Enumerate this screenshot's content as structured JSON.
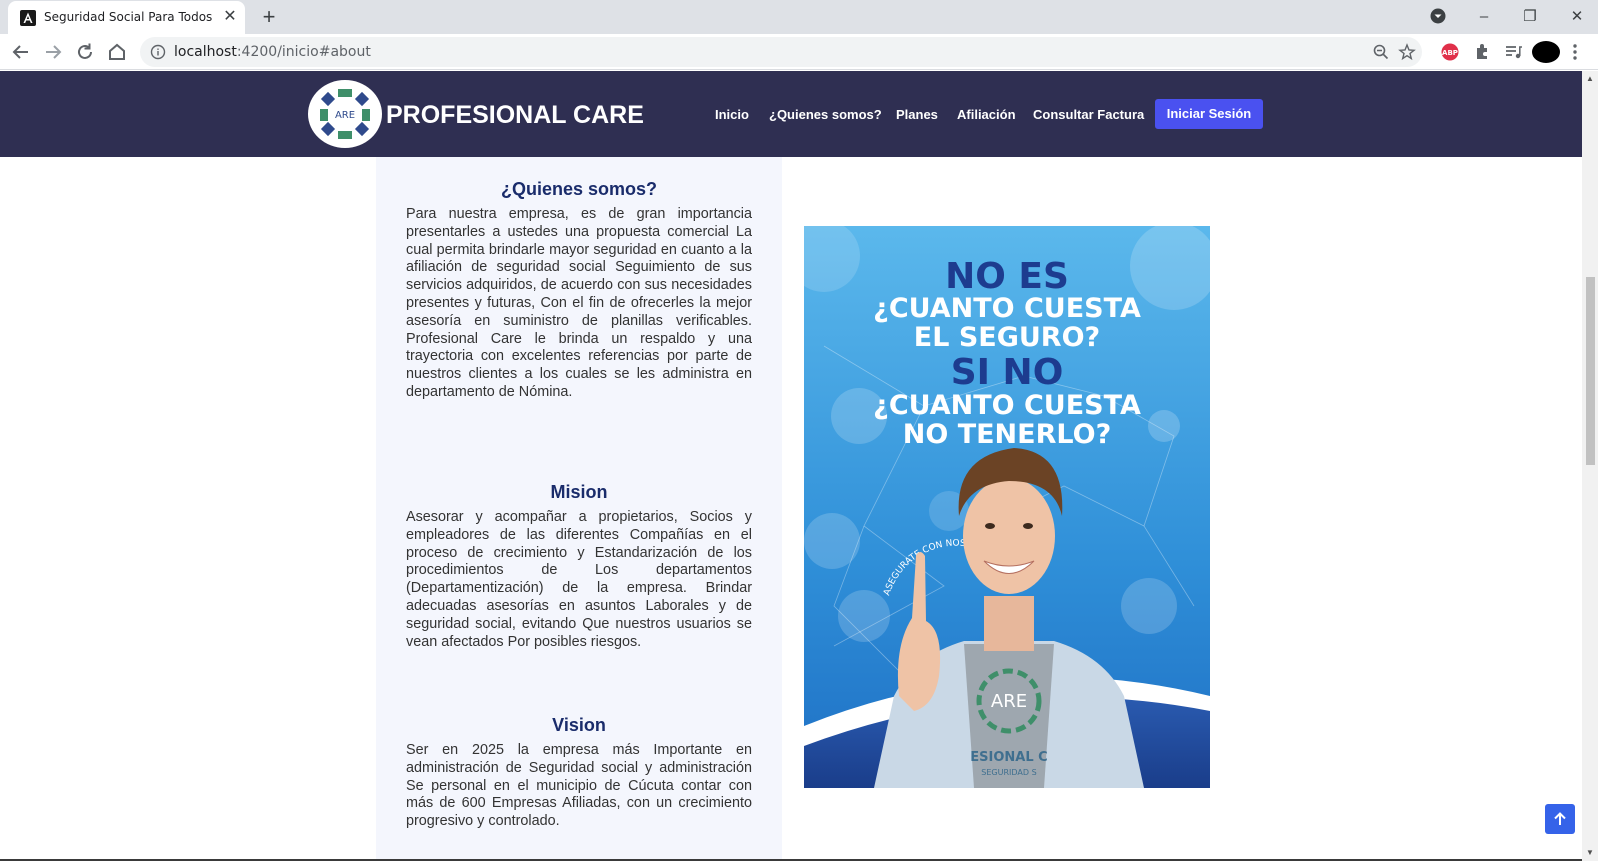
{
  "browser": {
    "tab_title": "Seguridad Social Para Todos",
    "url_host": "localhost",
    "url_rest": ":4200/inicio#about"
  },
  "nav": {
    "brand": "PROFESIONAL CARE",
    "logo_text": "ARE",
    "links": [
      "Inicio",
      "¿Quienes somos?",
      "Planes",
      "Afiliación",
      "Consultar Factura"
    ],
    "login": "Iniciar Sesión"
  },
  "about": {
    "title": "¿Quienes somos?",
    "text": "Para nuestra empresa, es de gran importancia presentarles a ustedes una propuesta comercial La cual permita brindarle mayor seguridad en cuanto a la afiliación de seguridad social Seguimiento de sus servicios adquiridos, de acuerdo con sus necesidades presentes y futuras, Con el fin de ofrecerles la mejor asesoría en suministro de planillas verificables. Profesional Care le brinda un respaldo y una trayectoria con excelentes referencias por parte de nuestros clientes a los cuales se les administra en departamento de Nómina."
  },
  "mision": {
    "title": "Mision",
    "text": "Asesorar y acompañar a propietarios, Socios y empleadores de las diferentes Compañías en el proceso de crecimiento y Estandarización de los procedimientos de Los departamentos (Departamentización) de la empresa. Brindar adecuadas asesorías en asuntos Laborales y de seguridad social, evitando Que nuestros usuarios se vean afectados Por posibles riesgos."
  },
  "vision": {
    "title": "Vision",
    "text": "Ser en 2025 la empresa más Importante en administración de Seguridad social y administración Se personal en el municipio de Cúcuta contar con más de 600 Empresas Afiliadas, con un crecimiento progresivo y controlado."
  },
  "poster": {
    "line1": "NO ES",
    "line2": "¿CUANTO CUESTA",
    "line3": "EL SEGURO?",
    "line4": "SI NO",
    "line5": "¿CUANTO CUESTA",
    "line6": "NO TENERLO?",
    "arc_text": "ASEGURATE CON NOSOTROS",
    "shirt_logo": "ARE",
    "shirt_line1": "ESIONAL C",
    "shirt_line2": "SEGURIDAD S"
  },
  "colors": {
    "navbar": "#2f2f52",
    "accent": "#4a51f0",
    "title": "#1a2c6b"
  }
}
